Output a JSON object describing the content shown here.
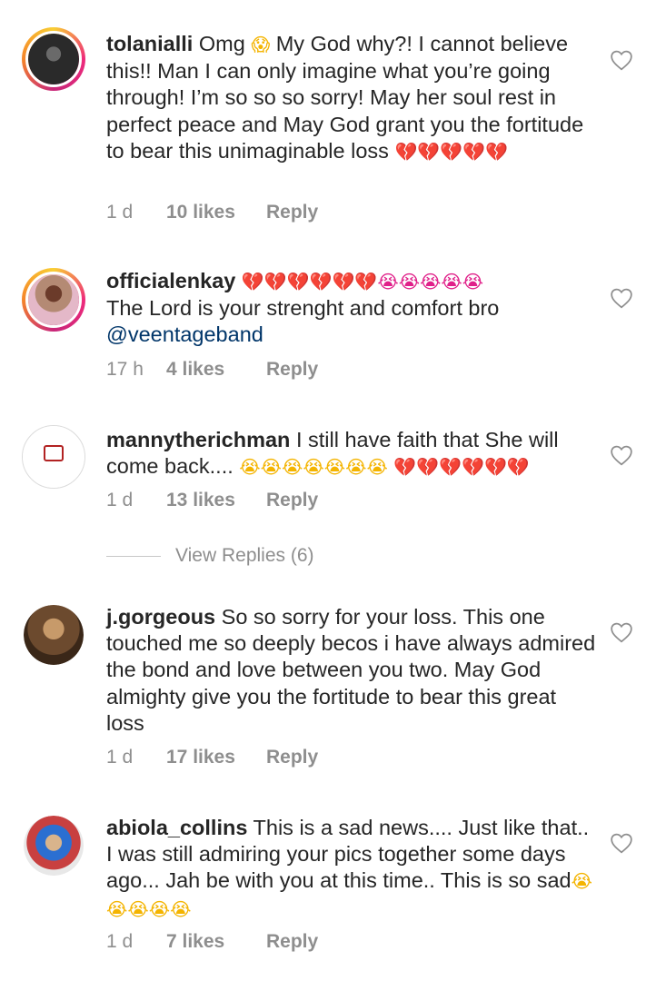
{
  "comments": [
    {
      "username": "tolanialli",
      "text_parts": [
        "Omg ",
        "😱",
        " My God why?! I cannot believe this!! Man I can only imagine what you’re going through! I’m so so so sorry! May her soul rest in perfect peace and May God grant you the fortitude to bear this unimaginable loss ",
        "💔💔💔💔💔"
      ],
      "time": "1 d",
      "likes": "10 likes",
      "reply": "Reply"
    },
    {
      "username": "officialenkay",
      "emojis": "💔💔💔💔💔💔😭😭😭😭😭",
      "text": "The Lord is your strenght and  comfort bro",
      "mention": "@veentageband",
      "time": "17 h",
      "likes": "4 likes",
      "reply": "Reply"
    },
    {
      "username": "mannytherichman",
      "text": "I still have faith that She will come back.... ",
      "emojis_cry": "😭😭😭😭😭😭😭",
      "emojis_heart": "💔💔💔💔💔💔",
      "time": "1 d",
      "likes": "13 likes",
      "reply": "Reply"
    },
    {
      "username": "j.gorgeous",
      "text": "So so sorry for your loss. This one touched me so deeply becos i have always admired the bond and love between you two. May God almighty give you the fortitude to bear this great loss",
      "time": "1 d",
      "likes": "17 likes",
      "reply": "Reply"
    },
    {
      "username": "abiola_collins",
      "text": "This is a sad news.... Just like that.. I was still admiring your pics together some days ago... Jah be with you at this time.. This is so sad",
      "emojis": "😭😭😭😭😭",
      "time": "1 d",
      "likes": "7 likes",
      "reply": "Reply"
    }
  ],
  "view_replies": "View Replies (6)",
  "icons": {
    "like": "heart-outline-icon"
  },
  "colors": {
    "text": "#262626",
    "meta": "#8e8e8e",
    "mention": "#003569",
    "heart_emoji": "#e0218a"
  }
}
